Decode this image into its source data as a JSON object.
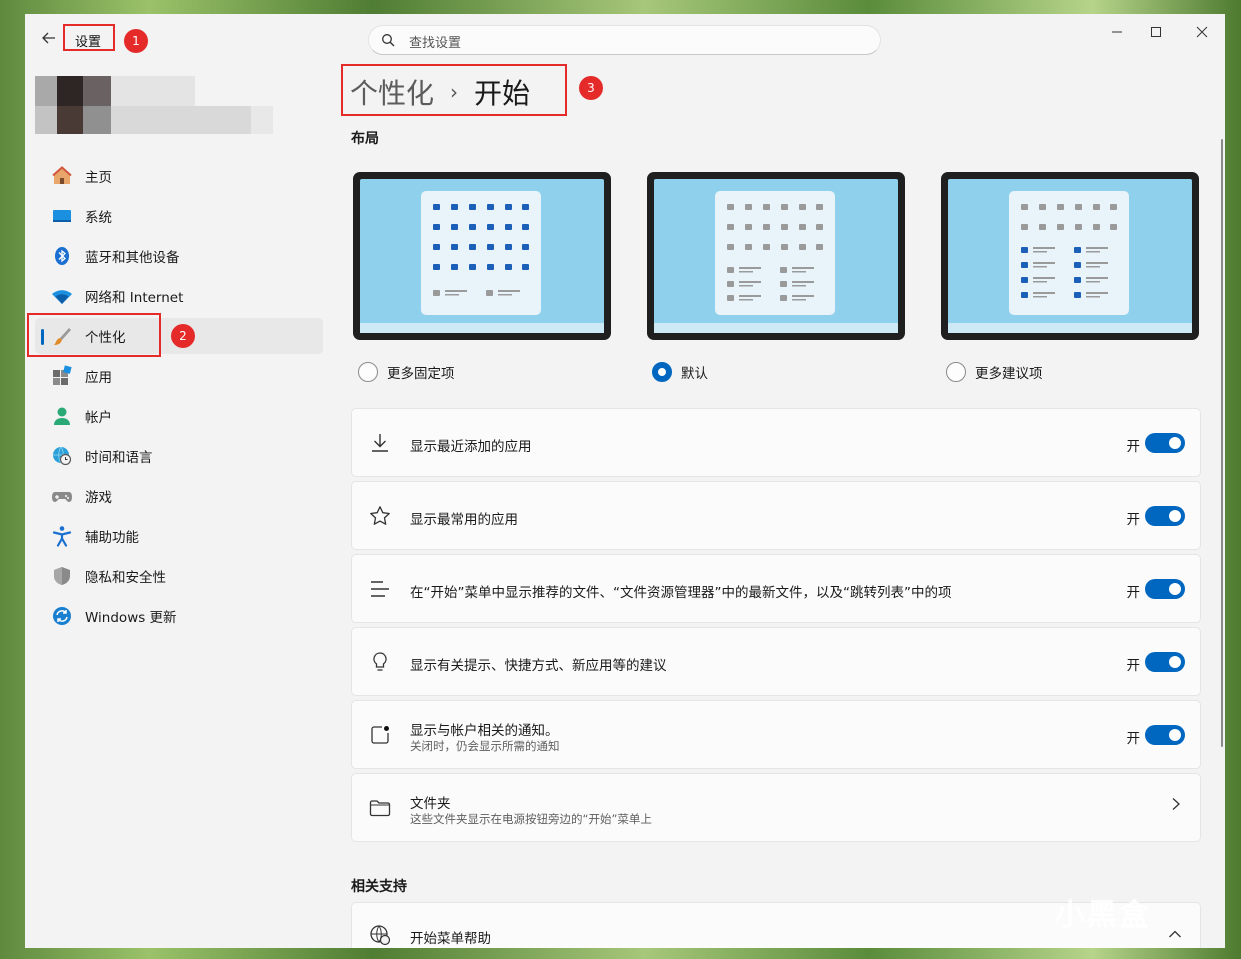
{
  "window": {
    "app_title": "设置",
    "search_placeholder": "查找设置"
  },
  "breadcrumb": {
    "parent": "个性化",
    "separator": "›",
    "current": "开始"
  },
  "sidebar": {
    "items": [
      {
        "label": "主页",
        "icon": "home-icon",
        "active": false
      },
      {
        "label": "系统",
        "icon": "system-icon",
        "active": false
      },
      {
        "label": "蓝牙和其他设备",
        "icon": "bluetooth-icon",
        "active": false
      },
      {
        "label": "网络和 Internet",
        "icon": "wifi-icon",
        "active": false
      },
      {
        "label": "个性化",
        "icon": "brush-icon",
        "active": true
      },
      {
        "label": "应用",
        "icon": "apps-icon",
        "active": false
      },
      {
        "label": "帐户",
        "icon": "account-icon",
        "active": false
      },
      {
        "label": "时间和语言",
        "icon": "globe-clock-icon",
        "active": false
      },
      {
        "label": "游戏",
        "icon": "gamepad-icon",
        "active": false
      },
      {
        "label": "辅助功能",
        "icon": "accessibility-icon",
        "active": false
      },
      {
        "label": "隐私和安全性",
        "icon": "shield-icon",
        "active": false
      },
      {
        "label": "Windows 更新",
        "icon": "update-icon",
        "active": false
      }
    ]
  },
  "layout_section": {
    "heading": "布局",
    "options": [
      {
        "label": "更多固定项",
        "selected": false
      },
      {
        "label": "默认",
        "selected": true
      },
      {
        "label": "更多建议项",
        "selected": false
      }
    ]
  },
  "settings": [
    {
      "title": "显示最近添加的应用",
      "subtitle": "",
      "state": "开",
      "icon": "download-icon"
    },
    {
      "title": "显示最常用的应用",
      "subtitle": "",
      "state": "开",
      "icon": "star-icon"
    },
    {
      "title": "在“开始”菜单中显示推荐的文件、“文件资源管理器”中的最新文件，以及“跳转列表”中的项",
      "subtitle": "",
      "state": "开",
      "icon": "list-icon"
    },
    {
      "title": "显示有关提示、快捷方式、新应用等的建议",
      "subtitle": "",
      "state": "开",
      "icon": "lightbulb-icon"
    },
    {
      "title": "显示与帐户相关的通知。",
      "subtitle": "关闭时，仍会显示所需的通知",
      "state": "开",
      "icon": "notification-icon"
    }
  ],
  "folders_row": {
    "title": "文件夹",
    "subtitle": "这些文件夹显示在电源按钮旁边的“开始”菜单上"
  },
  "related": {
    "heading": "相关支持",
    "item": "开始菜单帮助"
  },
  "annotations": [
    "1",
    "2",
    "3"
  ],
  "watermark": "小黑盒",
  "colors": {
    "accent": "#0067c0",
    "callout": "#e52a2a",
    "window_bg": "#f3f3f3",
    "card_bg": "#fbfbfb"
  }
}
